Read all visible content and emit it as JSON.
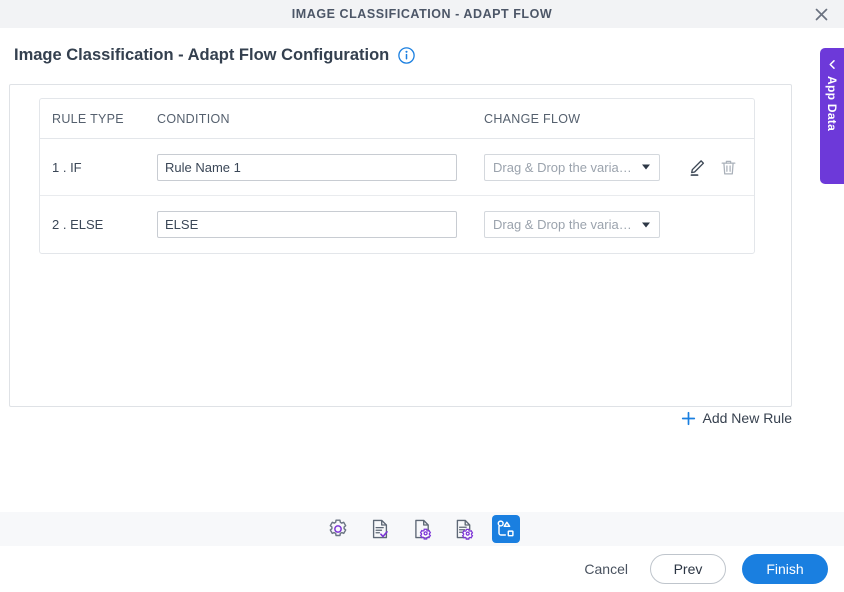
{
  "modal": {
    "title": "IMAGE CLASSIFICATION - ADAPT FLOW",
    "close_icon": "close-icon"
  },
  "page": {
    "title": "Image Classification - Adapt Flow Configuration",
    "info_icon": "info-icon",
    "back_icon": "arrow-left-icon"
  },
  "table": {
    "headers": {
      "rule_type": "RULE TYPE",
      "condition": "CONDITION",
      "change_flow": "CHANGE FLOW"
    },
    "rows": [
      {
        "rule_type": "1 . IF",
        "condition_value": "Rule Name 1",
        "change_flow_value": "Drag & Drop the varia…",
        "has_actions": true,
        "edit_icon": "pencil-icon",
        "delete_icon": "trash-icon"
      },
      {
        "rule_type": "2 . ELSE",
        "condition_value": "ELSE",
        "change_flow_value": "Drag & Drop the varia…",
        "has_actions": false
      }
    ]
  },
  "add_rule": {
    "label": "Add New Rule",
    "icon": "plus-icon"
  },
  "toolbar": {
    "items": [
      {
        "icon": "settings-gear-icon",
        "active": false
      },
      {
        "icon": "document-checklist-icon",
        "active": false
      },
      {
        "icon": "document-gear-icon",
        "active": false
      },
      {
        "icon": "document-list-gear-icon",
        "active": false
      },
      {
        "icon": "adapt-flow-diagram-icon",
        "active": true
      }
    ]
  },
  "footer": {
    "cancel_label": "Cancel",
    "prev_label": "Prev",
    "finish_label": "Finish"
  },
  "app_data_tab": {
    "label": "App Data",
    "chevron_icon": "chevron-left-icon"
  },
  "colors": {
    "accent_blue": "#1a7fe0",
    "purple": "#6d39d9",
    "icon_purple": "#7c34d6",
    "header_bg": "#f2f3f5",
    "text_dark": "#34404f",
    "placeholder_gray": "#9ba3ad"
  }
}
